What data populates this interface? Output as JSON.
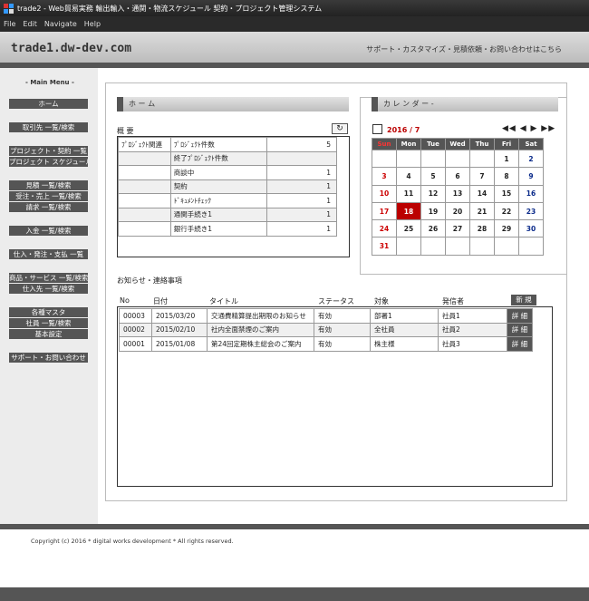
{
  "window": {
    "title": "trade2 - Web貿易実務 輸出輸入・通関・物流スケジュール 契約・プロジェクト管理システム"
  },
  "menubar": [
    "File",
    "Edit",
    "Navigate",
    "Help"
  ],
  "header": {
    "site_title": "trade1.dw-dev.com",
    "links": "サポート・カスタマイズ・見積依頼・お問い合わせはこちら"
  },
  "sidebar": {
    "title": "- Main Menu -",
    "items": [
      "ホーム",
      "取引先 一覧/検索",
      "プロジェクト・契約 一覧",
      "プロジェクト スケジュール",
      "見積 一覧/検索",
      "受注・売上 一覧/検索",
      "請求 一覧/検索",
      "入金 一覧/検索",
      "仕入・発注・支払 一覧",
      "商品・サービス 一覧/検索",
      "仕入先 一覧/検索",
      "各種マスタ",
      "社員 一覧/検索",
      "基本設定",
      "サポート・お問い合わせ"
    ]
  },
  "home": {
    "panel_title": "ホ ー ム",
    "summary_label": "概 要",
    "refresh_icon": "↻"
  },
  "summary": {
    "group": "ﾌﾟﾛｼﾞｪｸﾄ関連",
    "rows": [
      {
        "label": "ﾌﾟﾛｼﾞｪｸﾄ件数",
        "value": "5"
      },
      {
        "label": "終了ﾌﾟﾛｼﾞｪｸﾄ件数",
        "value": ""
      },
      {
        "label": "商談中",
        "value": "1"
      },
      {
        "label": "契約",
        "value": "1"
      },
      {
        "label": "ﾄﾞｷｭﾒﾝﾄﾁｪｯｸ",
        "value": "1"
      },
      {
        "label": "通関手続き1",
        "value": "1"
      },
      {
        "label": "銀行手続き1",
        "value": "1"
      }
    ]
  },
  "calendar": {
    "panel_title": "カ レ ン ダ ー -",
    "month": "2016 / 7",
    "nav": "◀◀ ◀ ▶ ▶▶",
    "days": [
      "Sun",
      "Mon",
      "Tue",
      "Wed",
      "Thu",
      "Fri",
      "Sat"
    ],
    "weeks": [
      [
        "",
        "",
        "",
        "",
        "",
        "1",
        "2"
      ],
      [
        "3",
        "4",
        "5",
        "6",
        "7",
        "8",
        "9"
      ],
      [
        "10",
        "11",
        "12",
        "13",
        "14",
        "15",
        "16"
      ],
      [
        "17",
        "18",
        "19",
        "20",
        "21",
        "22",
        "23"
      ],
      [
        "24",
        "25",
        "26",
        "27",
        "28",
        "29",
        "30"
      ],
      [
        "31",
        "",
        "",
        "",
        "",
        "",
        ""
      ]
    ],
    "today": "18"
  },
  "notices": {
    "title": "お知らせ・連絡事項",
    "headers": [
      "No",
      "日付",
      "タイトル",
      "ステータス",
      "対象",
      "発信者"
    ],
    "new_label": "新 規",
    "detail_label": "詳 細",
    "rows": [
      [
        "00003",
        "2015/03/20",
        "交通費精算提出期限のお知らせ",
        "有効",
        "部署1",
        "社員1"
      ],
      [
        "00002",
        "2015/02/10",
        "社内全面禁煙のご案内",
        "有効",
        "全社員",
        "社員2"
      ],
      [
        "00001",
        "2015/01/08",
        "第24回定期株主総会のご案内",
        "有効",
        "株主様",
        "社員3"
      ]
    ]
  },
  "footer": {
    "copyright": "Copyright (c) 2016 * digital works development * All rights reserved."
  }
}
